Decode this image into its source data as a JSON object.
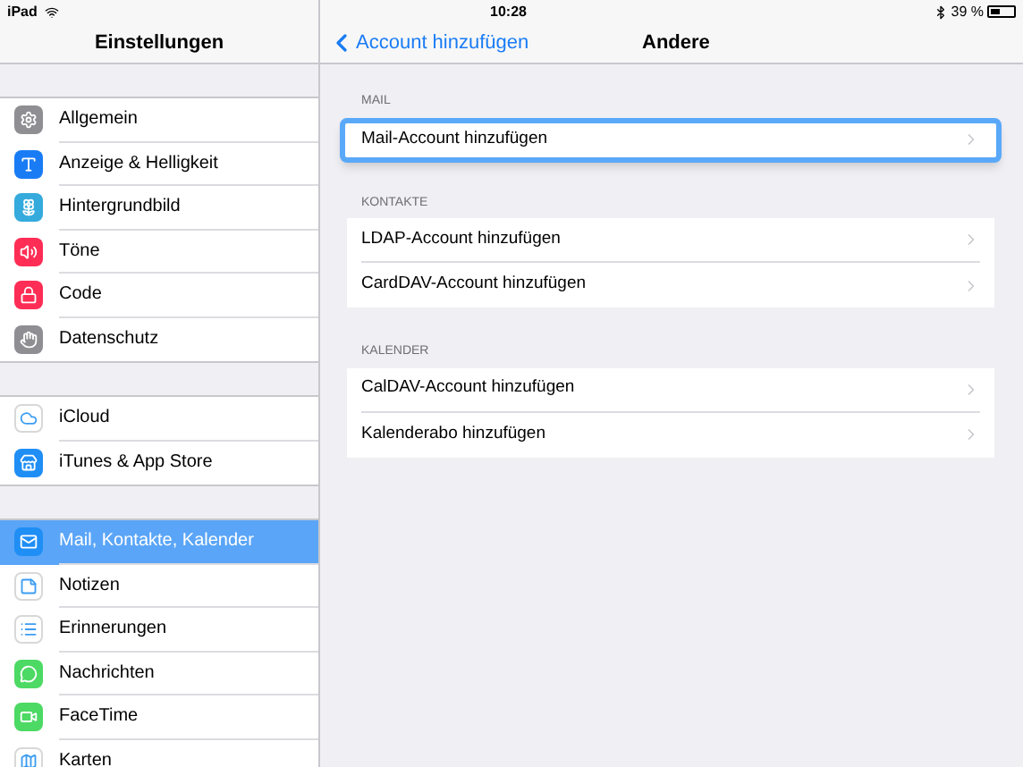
{
  "status_bar": {
    "device": "iPad",
    "time": "10:28",
    "battery": "39 %"
  },
  "sidebar": {
    "title": "Einstellungen",
    "groups": [
      {
        "items": [
          {
            "label": "Allgemein",
            "kind": "gear",
            "color": "#8e8e93",
            "selected": false
          },
          {
            "label": "Anzeige & Helligkeit",
            "kind": "text",
            "color": "#1a7cf5",
            "selected": false
          },
          {
            "label": "Hintergrundbild",
            "kind": "flower",
            "color": "#35aadc",
            "selected": false
          },
          {
            "label": "Töne",
            "kind": "speaker",
            "color": "#fe2d55",
            "selected": false
          },
          {
            "label": "Code",
            "kind": "lock",
            "color": "#fe2d55",
            "selected": false
          },
          {
            "label": "Datenschutz",
            "kind": "hand",
            "color": "#8e8e93",
            "selected": false
          }
        ]
      },
      {
        "items": [
          {
            "label": "iCloud",
            "kind": "cloud",
            "color": "#ffffff",
            "selected": false
          },
          {
            "label": "iTunes & App Store",
            "kind": "store",
            "color": "#1f8ef5",
            "selected": false
          }
        ]
      },
      {
        "items": [
          {
            "label": "Mail, Kontakte, Kalender",
            "kind": "mail",
            "color": "#1f8ef5",
            "selected": true
          },
          {
            "label": "Notizen",
            "kind": "notes",
            "color": "#ffffff",
            "selected": false
          },
          {
            "label": "Erinnerungen",
            "kind": "list",
            "color": "#ffffff",
            "selected": false
          },
          {
            "label": "Nachrichten",
            "kind": "message",
            "color": "#4cd964",
            "selected": false
          },
          {
            "label": "FaceTime",
            "kind": "video",
            "color": "#4cd964",
            "selected": false
          },
          {
            "label": "Karten",
            "kind": "map",
            "color": "#ffffff",
            "selected": false
          }
        ]
      }
    ]
  },
  "detail": {
    "back": "Account hinzufügen",
    "title": "Andere",
    "sections": [
      {
        "header": "MAIL",
        "items": [
          {
            "label": "Mail-Account hinzufügen",
            "selected": true
          }
        ]
      },
      {
        "header": "KONTAKTE",
        "items": [
          {
            "label": "LDAP-Account hinzufügen",
            "selected": false
          },
          {
            "label": "CardDAV-Account hinzufügen",
            "selected": false
          }
        ]
      },
      {
        "header": "KALENDER",
        "items": [
          {
            "label": "CalDAV-Account hinzufügen",
            "selected": false
          },
          {
            "label": "Kalenderabo hinzufügen",
            "selected": false
          }
        ]
      }
    ]
  }
}
